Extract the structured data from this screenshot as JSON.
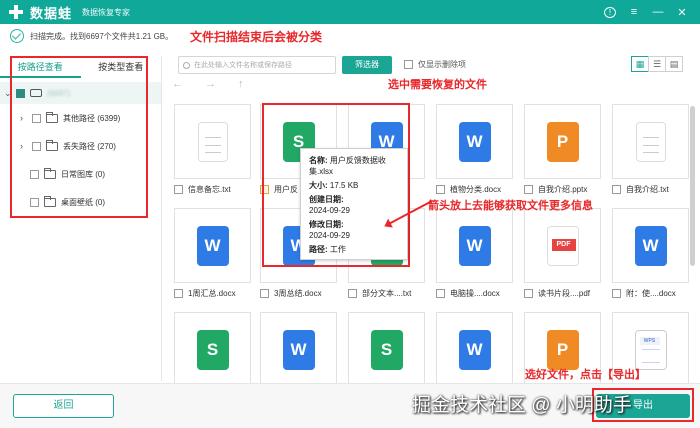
{
  "titlebar": {
    "app_name": "数据蛙",
    "subtitle": "数据恢复专家",
    "info": "!",
    "menu": "≡",
    "minimize": "—",
    "close": "✕"
  },
  "status": {
    "text": "扫描完成。找到6697个文件共1.21 GB。"
  },
  "annotations": {
    "classified": "文件扫描结束后会被分类",
    "select": "选中需要恢复的文件",
    "hover": "箭头放上去能够获取文件更多信息",
    "export": "选好文件，点击【导出】"
  },
  "left_panel": {
    "tabs": [
      {
        "label": "按路径查看",
        "active": true
      },
      {
        "label": "按类型查看",
        "active": false
      }
    ],
    "root_label": "(6697)",
    "root_blur": "",
    "items": [
      {
        "label": "其他路径 (6399)",
        "expandable": true
      },
      {
        "label": "丢失路径 (270)",
        "expandable": true
      },
      {
        "label": "日常图库 (0)",
        "expandable": false
      },
      {
        "label": "桌面壁纸 (0)",
        "expandable": false
      }
    ]
  },
  "toolbar": {
    "search_placeholder": "在此处输入文件名称或保存路径",
    "filter_label": "筛选器",
    "only_deleted_label": "仅显示删除项"
  },
  "files": [
    {
      "name": "信息备忘.txt",
      "type": "txt",
      "checked": false
    },
    {
      "name": "用户反",
      "type": "s",
      "checked": true
    },
    {
      "name": "...",
      "type": "w",
      "checked": false
    },
    {
      "name": "植物分类.docx",
      "type": "w",
      "checked": false
    },
    {
      "name": "自我介绍.pptx",
      "type": "p",
      "checked": false
    },
    {
      "name": "自我介绍.txt",
      "type": "txt",
      "checked": false
    },
    {
      "name": "1周汇总.docx",
      "type": "w",
      "checked": false
    },
    {
      "name": "3周总结.docx",
      "type": "w",
      "checked": false
    },
    {
      "name": "部分文本....txt",
      "type": "s",
      "checked": false
    },
    {
      "name": "电脑操....docx",
      "type": "w",
      "checked": false
    },
    {
      "name": "读书片段....pdf",
      "type": "pdf",
      "checked": false
    },
    {
      "name": "附：使....docx",
      "type": "w",
      "checked": false
    },
    {
      "name": "",
      "type": "s",
      "checked": false
    },
    {
      "name": "",
      "type": "w",
      "checked": false
    },
    {
      "name": "",
      "type": "s",
      "checked": false
    },
    {
      "name": "",
      "type": "w",
      "checked": false
    },
    {
      "name": "",
      "type": "p",
      "checked": false
    },
    {
      "name": "",
      "type": "wps",
      "checked": false
    }
  ],
  "icon_glyphs": {
    "s": "S",
    "w": "W",
    "p": "P",
    "pdf": "PDF",
    "wps": "WPS"
  },
  "tooltip": {
    "name_label": "名称:",
    "name_value": "用户反馈数据收集.xlsx",
    "size_label": "大小:",
    "size_value": "17.5 KB",
    "created_label": "创建日期:",
    "created_value": "2024-09-29",
    "modified_label": "修改日期:",
    "modified_value": "2024-09-29",
    "path_label": "路径:",
    "path_value": "工作"
  },
  "bottom": {
    "back_label": "返回",
    "export_label": "导出"
  },
  "watermark": "掘金技术社区 @ 小明助手",
  "colors": {
    "accent": "#1aa594",
    "annotation": "#e8282b"
  }
}
